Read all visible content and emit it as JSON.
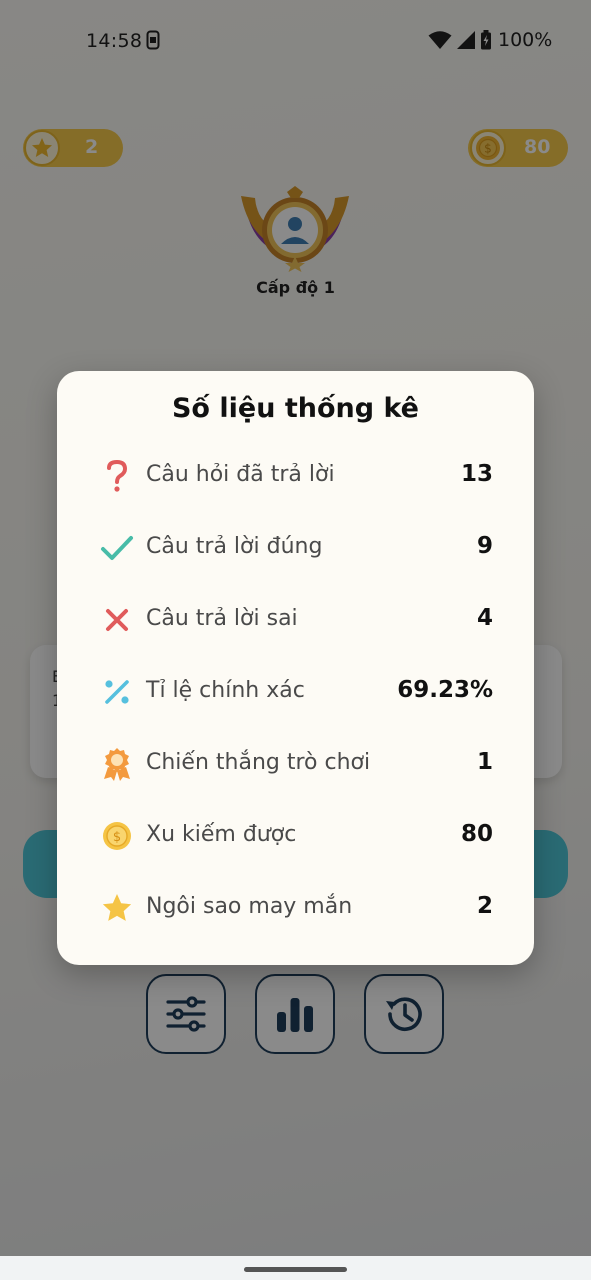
{
  "status_bar": {
    "time": "14:58",
    "battery": "100%"
  },
  "header": {
    "stars": "2",
    "coins": "80"
  },
  "profile": {
    "level": "Cấp độ 1"
  },
  "background_card": {
    "line1": "E",
    "line2": "1"
  },
  "bottom_nav": {
    "icons": [
      "sliders-icon",
      "bar-chart-icon",
      "history-icon"
    ]
  },
  "dialog": {
    "title": "Số liệu thống kê",
    "rows": [
      {
        "icon": "question-icon",
        "label": "Câu hỏi đã trả lời",
        "value": "13",
        "color": "#e05b5b"
      },
      {
        "icon": "check-icon",
        "label": "Câu trả lời đúng",
        "value": "9",
        "color": "#48bca8"
      },
      {
        "icon": "cross-icon",
        "label": "Câu trả lời sai",
        "value": "4",
        "color": "#e05b5b"
      },
      {
        "icon": "percent-icon",
        "label": "Tỉ lệ chính xác",
        "value": "69.23%",
        "color": "#56c0de"
      },
      {
        "icon": "award-icon",
        "label": "Chiến thắng trò chơi",
        "value": "1",
        "color": "#f39a3e"
      },
      {
        "icon": "coin-icon",
        "label": "Xu kiếm được",
        "value": "80",
        "color": "#f5c445"
      },
      {
        "icon": "star-icon",
        "label": "Ngôi sao may mắn",
        "value": "2",
        "color": "#f5c445"
      }
    ]
  },
  "colors": {
    "accent": "#4fc6d6",
    "gold": "#f6c94a",
    "dark": "#1f3d5b"
  }
}
